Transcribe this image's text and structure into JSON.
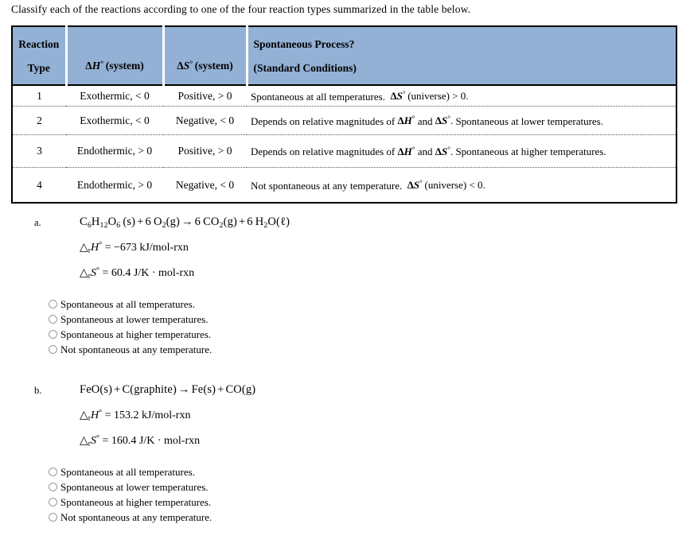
{
  "prompt": "Classify each of the reactions according to one of the four reaction types summarized in the table below.",
  "table": {
    "accent_color": "#93b0d5",
    "headers": {
      "reaction_type_line1": "Reaction",
      "reaction_type_line2": "Type",
      "delta_h": "ΔH° (system)",
      "delta_s": "ΔS° (system)",
      "spontaneous_line1": "Spontaneous Process?",
      "spontaneous_line2": "(Standard Conditions)"
    },
    "rows": [
      {
        "type": "1",
        "dh": "Exothermic, < 0",
        "ds": "Positive, > 0",
        "desc": "Spontaneous at all temperatures. ΔS° (universe) > 0."
      },
      {
        "type": "2",
        "dh": "Exothermic, < 0",
        "ds": "Negative, < 0",
        "desc": "Depends on relative magnitudes of ΔH° and ΔS°. Spontaneous at lower temperatures."
      },
      {
        "type": "3",
        "dh": "Endothermic, > 0",
        "ds": "Positive, > 0",
        "desc": "Depends on relative magnitudes of ΔH° and ΔS°. Spontaneous at higher temperatures."
      },
      {
        "type": "4",
        "dh": "Endothermic, > 0",
        "ds": "Negative, < 0",
        "desc": "Not spontaneous at any temperature. ΔS° (universe) < 0."
      }
    ]
  },
  "questions": [
    {
      "label": "a.",
      "equation": "C6H12O6 (s) + 6 O2 (g) → 6 CO2 (g) + 6 H2O(ℓ)",
      "delta_h_value": "−673 kJ/mol-rxn",
      "delta_s_value": "60.4 J/K · mol-rxn",
      "options": [
        "Spontaneous at all temperatures.",
        "Spontaneous at lower temperatures.",
        "Spontaneous at higher temperatures.",
        "Not spontaneous at any temperature."
      ],
      "selected": null
    },
    {
      "label": "b.",
      "equation": "FeO(s) + C(graphite) → Fe(s) + CO(g)",
      "delta_h_value": "153.2 kJ/mol-rxn",
      "delta_s_value": "160.4 J/K · mol-rxn",
      "options": [
        "Spontaneous at all temperatures.",
        "Spontaneous at lower temperatures.",
        "Spontaneous at higher temperatures.",
        "Not spontaneous at any temperature."
      ],
      "selected": null
    }
  ]
}
